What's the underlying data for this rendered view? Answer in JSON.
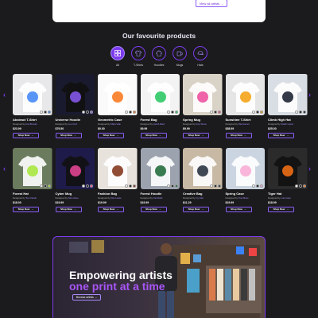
{
  "top_card": {
    "view_all_label": "View all artists →"
  },
  "section": {
    "title": "Our favourite products"
  },
  "categories": [
    {
      "label": "All",
      "icon": "grid-icon",
      "active": true
    },
    {
      "label": "T-Shirts",
      "icon": "tshirt-icon",
      "active": false
    },
    {
      "label": "Hoodies",
      "icon": "hoodie-icon",
      "active": false
    },
    {
      "label": "Mugs",
      "icon": "mug-icon",
      "active": false
    },
    {
      "label": "Hats",
      "icon": "hat-icon",
      "active": false
    }
  ],
  "shop_now_label": "Shop Now",
  "row1": [
    {
      "name": "Abstract T-Shirt",
      "designer": "Ana Brooks",
      "price": "$23.99",
      "bg": "#e8e8ea",
      "accent": "#3b82f6"
    },
    {
      "name": "Universe Hoodie",
      "designer": "Leo Cruz",
      "price": "$79.50",
      "bg": "#1a1a2e",
      "accent": "#8b5cf6"
    },
    {
      "name": "Geometric Case",
      "designer": "Mara Vale",
      "price": "$0.00",
      "bg": "#fafafa",
      "accent": "#f97316"
    },
    {
      "name": "Forest Bag",
      "designer": "Jacob Reid",
      "price": "$9.99",
      "bg": "#f3f3f3",
      "accent": "#22c55e"
    },
    {
      "name": "Spring Mug",
      "designer": "Amy Stone",
      "price": "$9.99",
      "bg": "#d9d2c6",
      "accent": "#ec4899"
    },
    {
      "name": "Sunshine T-Shirt",
      "designer": "Ria Gomez",
      "price": "$38.99",
      "bg": "#e5e5e5",
      "accent": "#f59e0b"
    },
    {
      "name": "Climb High Hat",
      "designer": "Sarah Lopez",
      "price": "$25.00",
      "bg": "#d9dde4",
      "accent": "#111827"
    }
  ],
  "row2": [
    {
      "name": "Forest Hat",
      "designer": "Tom Fields",
      "price": "$18.00",
      "bg": "#6b7b5e",
      "accent": "#a3e635"
    },
    {
      "name": "Cyber Mug",
      "designer": "Nico Kane",
      "price": "$19.99",
      "bg": "#1e1b4b",
      "accent": "#ec4899"
    },
    {
      "name": "Fashion Bag",
      "designer": "Dan Lewis",
      "price": "$19.99",
      "bg": "#e7e2dc",
      "accent": "#7c2d12"
    },
    {
      "name": "Forest Hoodie",
      "designer": "Kai Wells",
      "price": "$19.99",
      "bg": "#9ca3af",
      "accent": "#166534"
    },
    {
      "name": "Creative Bag",
      "designer": "Ivy Hart",
      "price": "$11.29",
      "bg": "#c7b9a4",
      "accent": "#1f2937"
    },
    {
      "name": "Spring Case",
      "designer": "Tina Moss",
      "price": "$19.99",
      "bg": "#cbd5e1",
      "accent": "#f9a8d4"
    },
    {
      "name": "Tiger Hat",
      "designer": "Luis Cano",
      "price": "$18.99",
      "bg": "#2b2b2b",
      "accent": "#f97316"
    }
  ],
  "banner": {
    "headline_1": "Empowering artists",
    "headline_2": "one print at a time",
    "button_label": "Browse artists →"
  }
}
